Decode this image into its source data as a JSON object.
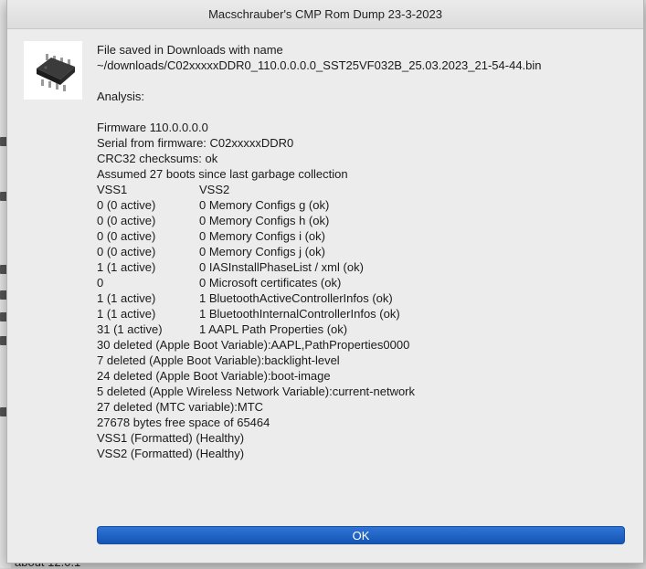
{
  "dialog": {
    "title": "Macschrauber's CMP Rom Dump 23-3-2023",
    "saved_line": "File saved in Downloads with name",
    "path": "~/downloads/C02xxxxxDDR0_110.0.0.0.0_SST25VF032B_25.03.2023_21-54-44.bin",
    "analysis_label": "Analysis:",
    "firmware": "Firmware 110.0.0.0.0",
    "serial": "Serial from firmware: C02xxxxxDDR0",
    "crc": "CRC32 checksums: ok",
    "boots": "Assumed 27 boots since last garbage collection",
    "table": {
      "headers": [
        "VSS1",
        "VSS2"
      ],
      "rows": [
        [
          "0 (0 active)",
          "0 Memory Configs g (ok)"
        ],
        [
          "0 (0 active)",
          "0 Memory Configs h (ok)"
        ],
        [
          "0 (0 active)",
          "0 Memory Configs i (ok)"
        ],
        [
          "0 (0 active)",
          "0 Memory Configs j (ok)"
        ],
        [
          "1 (1 active)",
          "0 IASInstallPhaseList / xml (ok)"
        ],
        [
          "0",
          "0 Microsoft certificates (ok)"
        ],
        [
          "1 (1 active)",
          "1 BluetoothActiveControllerInfos (ok)"
        ],
        [
          "1 (1 active)",
          "1 BluetoothInternalControllerInfos (ok)"
        ],
        [
          "31 (1 active)",
          "1 AAPL Path Properties (ok)"
        ]
      ]
    },
    "details": [
      "30 deleted (Apple Boot Variable):AAPL,PathProperties0000",
      "7 deleted (Apple Boot Variable):backlight-level",
      "24 deleted (Apple Boot Variable):boot-image",
      "5 deleted (Apple Wireless Network Variable):current-network",
      "27 deleted (MTC variable):MTC",
      "27678 bytes free space of 65464",
      "VSS1 (Formatted) (Healthy)",
      "VSS2 (Formatted) (Healthy)"
    ],
    "ok_label": "OK",
    "icon": "chip-icon"
  },
  "background": {
    "partial_text": "about 12.0.1"
  },
  "colors": {
    "ok_button": "#1a5fcc",
    "dialog_bg": "#ececec"
  }
}
